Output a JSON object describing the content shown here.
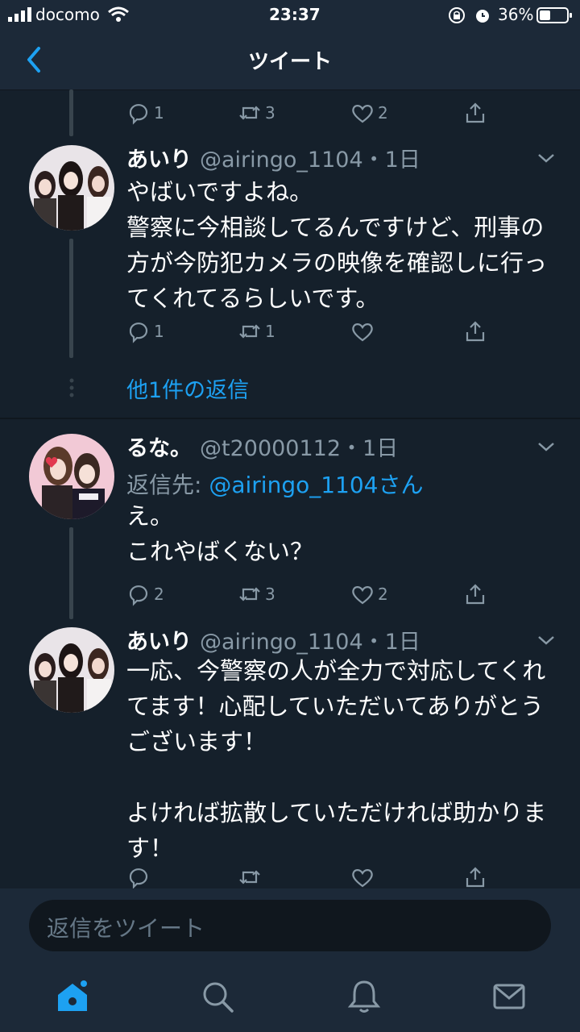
{
  "status_bar": {
    "carrier": "docomo",
    "time": "23:37",
    "battery": "36%"
  },
  "header": {
    "title": "ツイート"
  },
  "tweet_top_actions": {
    "reply_count": "1",
    "retweet_count": "3",
    "like_count": "2"
  },
  "tweet1": {
    "name": "あいり",
    "handle": "@airingo_1104",
    "time": "・1日",
    "text": "やばいですよね。\n警察に今相談してるんですけど、刑事の方が今防犯カメラの映像を確認しに行ってくれてるらしいです。",
    "reply_count": "1",
    "retweet_count": "1",
    "like_count": ""
  },
  "more_replies": "他1件の返信",
  "tweet2": {
    "name": "るな。",
    "handle": "@t20000112",
    "time": "・1日",
    "reply_to_label": "返信先: ",
    "reply_to_user": "@airingo_1104さん",
    "text": "え。\nこれやばくない？",
    "reply_count": "2",
    "retweet_count": "3",
    "like_count": "2"
  },
  "tweet3": {
    "name": "あいり",
    "handle": "@airingo_1104",
    "time": "・1日",
    "text": "一応、今警察の人が全力で対応してくれてます！心配していただいてありがとうございます！\n\nよければ拡散していただければ助かります！",
    "reply_count": "",
    "retweet_count": "",
    "like_count": ""
  },
  "compose": {
    "placeholder": "返信をツイート"
  },
  "colors": {
    "background": "#15202b",
    "bar": "#1c2938",
    "accent": "#1da1f2",
    "secondary": "#8899a6"
  }
}
